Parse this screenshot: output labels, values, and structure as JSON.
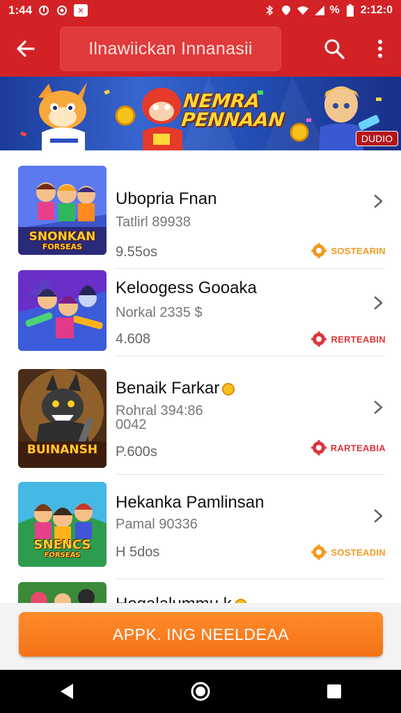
{
  "status_bar": {
    "time": "1:44",
    "icons_left": [
      "ellipse-icon",
      "notification-icon",
      "target-icon",
      "block-icon"
    ],
    "icons_right": [
      "bluetooth-icon",
      "location-icon",
      "wifi-icon",
      "signal-icon",
      "battery-icon"
    ],
    "battery_text": "%",
    "clock_right": "2:12:0"
  },
  "app_bar": {
    "title": "Ilnawiickan Innanasii",
    "back_icon": "arrow-back-icon",
    "search_icon": "search-icon",
    "more_icon": "more-vertical-icon"
  },
  "banner": {
    "title_line1": "NEMRA",
    "title_line2": "PENNAAN",
    "badge": "DUDIO"
  },
  "games": [
    {
      "title": "Ubopria Fnan",
      "subtitle": "Tatlirl 89938",
      "size": "9.55os",
      "tag": "SOSTEARIN",
      "tag_color": "#f29a1f",
      "thumb_text": "SNONKAN",
      "thumb_subtext": "FORSEAS",
      "has_coin": false
    },
    {
      "title": "Keloogess Gooaka",
      "subtitle": "Norkal 2335 $",
      "size": "4.608",
      "tag": "RERTEABIN",
      "tag_color": "#d9363b",
      "thumb_text": "",
      "thumb_subtext": "",
      "has_coin": false
    },
    {
      "title": "Benaik Farkar",
      "subtitle": "Rohral 394:86",
      "subtitle2": "0042",
      "size": "P.600s",
      "tag": "RARTEABIA",
      "tag_color": "#d9363b",
      "thumb_text": "BUINANSH",
      "thumb_subtext": "",
      "has_coin": true
    },
    {
      "title": "Hekanka Pamlinsan",
      "subtitle": "Pamal 90336",
      "size": "H 5dos",
      "tag": "SOSTEADIN",
      "tag_color": "#f29a1f",
      "thumb_text": "SNENCS",
      "thumb_subtext": "FORSEAS",
      "has_coin": false
    },
    {
      "title": "Hogalalummu k",
      "has_coin": true
    }
  ],
  "action_button": {
    "label": "APPK. ING NEELDEAA"
  },
  "nav_bar": {
    "back": "nav-back-icon",
    "home": "nav-home-icon",
    "recents": "nav-recents-icon"
  },
  "colors": {
    "primary": "#d32226",
    "accent": "#f47316",
    "tag_orange": "#f29a1f",
    "tag_red": "#d9363b"
  }
}
